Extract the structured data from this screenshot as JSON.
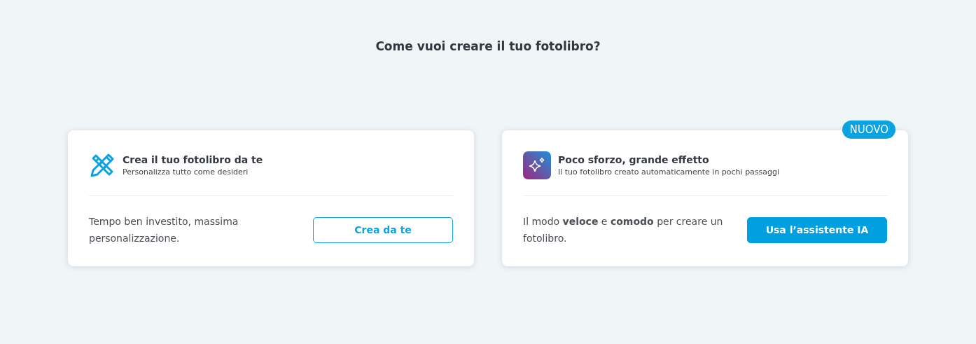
{
  "heading": "Come vuoi creare il tuo fotolibro?",
  "cards": [
    {
      "kind": "manual",
      "title": "Crea il tuo fotolibro da te",
      "subtitle": "Personalizza tutto come desideri",
      "description": "Tempo ben investito, massima personalizzazione.",
      "button": {
        "label": "Crea da te",
        "kind": "outline"
      }
    },
    {
      "kind": "assistant",
      "badge": "NUOVO",
      "title": "Poco sforzo, grande effetto",
      "subtitle": "Il tuo fotolibro creato automaticamente in pochi passaggi",
      "description": "Il modo **veloce** e **comodo** per creare un fotolibro.",
      "button": {
        "label": "Usa l’assistente IA",
        "kind": "filled"
      }
    }
  ]
}
